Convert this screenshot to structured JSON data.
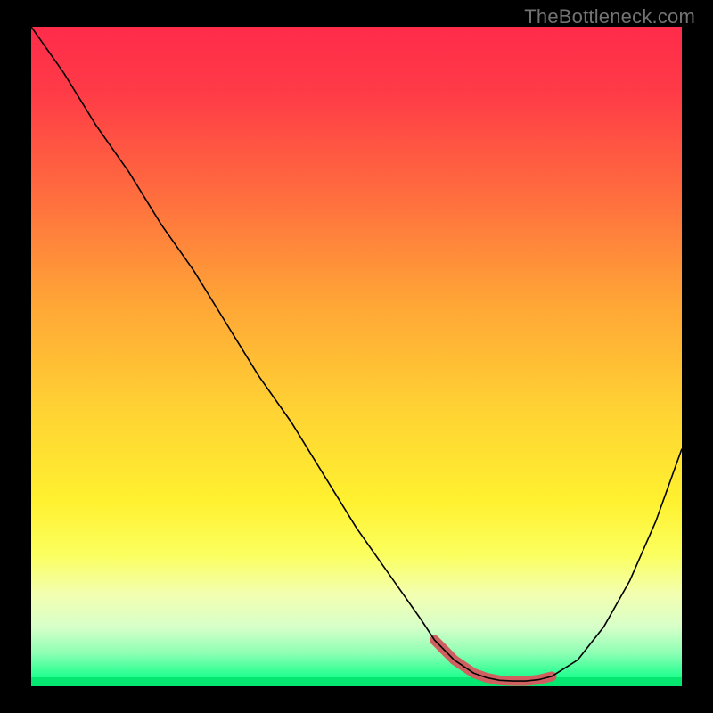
{
  "watermark": "TheBottleneck.com",
  "chart_data": {
    "type": "line",
    "title": "",
    "xlabel": "",
    "ylabel": "",
    "xlim": [
      0,
      100
    ],
    "ylim": [
      0,
      100
    ],
    "grid": false,
    "legend": false,
    "series": [
      {
        "name": "curve",
        "x": [
          0,
          5,
          10,
          15,
          20,
          25,
          30,
          35,
          40,
          45,
          50,
          55,
          60,
          62,
          65,
          68,
          70,
          72,
          74,
          76,
          78,
          80,
          84,
          88,
          92,
          96,
          100
        ],
        "values": [
          100,
          93,
          85,
          78,
          70,
          63,
          55,
          47,
          40,
          32,
          24,
          17,
          10,
          7,
          4,
          2,
          1.3,
          0.9,
          0.8,
          0.8,
          1.0,
          1.5,
          4,
          9,
          16,
          25,
          36
        ]
      },
      {
        "name": "highlight-segment",
        "x": [
          62,
          65,
          68,
          70,
          72,
          74,
          76,
          78,
          80
        ],
        "values": [
          7,
          4,
          2,
          1.3,
          0.9,
          0.8,
          0.8,
          1.0,
          1.5
        ]
      }
    ],
    "background": "rainbow-gradient-red-to-green-vertical"
  }
}
